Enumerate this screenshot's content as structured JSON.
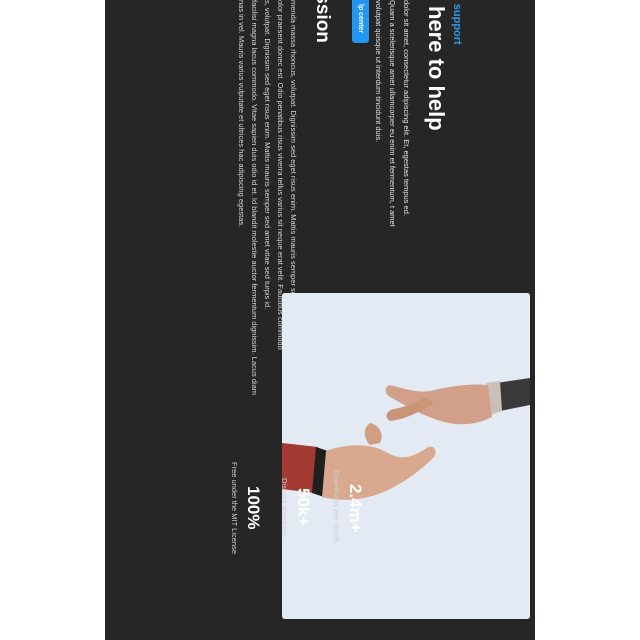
{
  "support": {
    "eyebrow": "g support",
    "heading": "here to help",
    "intro": "dolor sit amet, consectetur adipiscing elit. Et, egestas tempus ed. Quam a scelerisque amet ullamcorper eu enim et fermentum, t amet volutpat quisque ut interdum tincidunt duis.",
    "button_label": "lp center"
  },
  "mission": {
    "title": "ission",
    "paragraphs": [
      "menda massa rhoncus, volutpat. Dignissim sed eget risus enim. Mattis mauris semper sed amet vitae sed",
      "olor praesent donec est. Odio penatibus risus viverra tellus varius sit neque erat velit. Faucibus commodo",
      "s, volutpat. Dignissim sed eget risus enim. Mattis mauris semper sed amet vitae sed turpis id.",
      "facilisi magna lacus commodo. Vitae sapien duis odio id et. Id blandit molestie auctor fermentum dignissim. Lacus diam",
      "nas in vel. Mauris varius vulputate et ultrices hac adipiscing egestas."
    ]
  },
  "stats": [
    {
      "value": "2.4m+",
      "label": "Downloads per month"
    },
    {
      "value": "50k+",
      "label": "Discord members"
    },
    {
      "value": "100%",
      "label": "Free under the MIT License"
    }
  ],
  "image": {
    "subject": "two hands reaching toward each other"
  },
  "colors": {
    "panel": "#262626",
    "accent": "#2196f3",
    "link": "#2f9be6"
  }
}
